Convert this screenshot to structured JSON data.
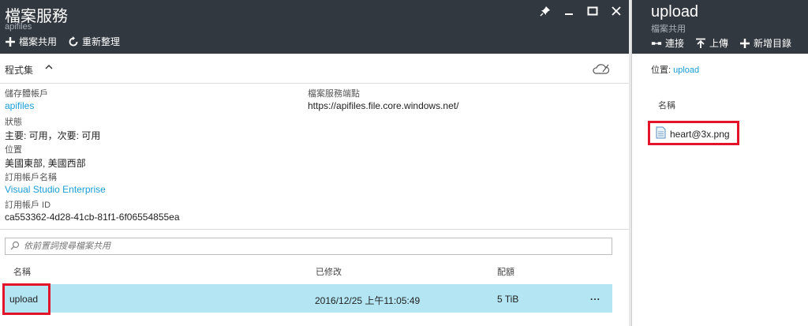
{
  "left": {
    "title": "檔案服務",
    "subtitle": "apifiles",
    "toolbar": {
      "add_label": "檔案共用",
      "refresh_label": "重新整理"
    },
    "essentials": {
      "label": "程式集"
    },
    "props": {
      "storage_label": "儲存體帳戶",
      "storage_value": "apifiles",
      "status_label": "狀態",
      "status_value": "主要: 可用，次要: 可用",
      "location_label": "位置",
      "location_value": "美國東部, 美國西部",
      "subscription_label": "訂用帳戶名稱",
      "subscription_value": "Visual Studio Enterprise",
      "subid_label": "訂用帳戶 ID",
      "subid_value": "ca553362-4d28-41cb-81f1-6f06554855ea",
      "endpoint_label": "檔案服務端點",
      "endpoint_value": "https://apifiles.file.core.windows.net/"
    },
    "search": {
      "placeholder": "依前置詞搜尋檔案共用"
    },
    "table": {
      "headers": {
        "name": "名稱",
        "modified": "已修改",
        "quota": "配額"
      },
      "rows": [
        {
          "name": "upload",
          "modified": "2016/12/25 上午11:05:49",
          "quota": "5 TiB",
          "more": "..."
        }
      ]
    }
  },
  "right": {
    "title": "upload",
    "subtitle": "檔案共用",
    "toolbar": {
      "connect_label": "連接",
      "upload_label": "上傳",
      "newdir_label": "新增目錄"
    },
    "location_label": "位置:",
    "location_value": "upload",
    "col_name": "名稱",
    "files": [
      {
        "name": "heart@3x.png"
      }
    ]
  },
  "colors": {
    "header_bg": "#32383f",
    "link": "#1a9cd6",
    "selected_row": "#b3e5f3",
    "highlight": "#e3132a"
  }
}
